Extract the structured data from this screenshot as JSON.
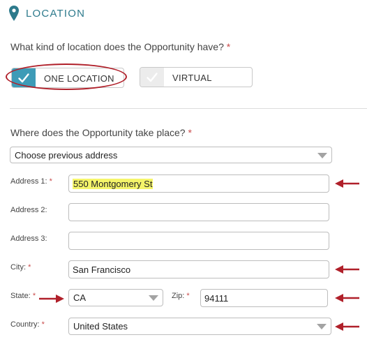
{
  "section": {
    "title": "LOCATION",
    "icon": "map-pin-icon"
  },
  "location_type": {
    "question": "What kind of location does the Opportunity have?",
    "required_mark": "*",
    "options": [
      {
        "label": "ONE LOCATION",
        "selected": true
      },
      {
        "label": "VIRTUAL",
        "selected": false
      }
    ]
  },
  "address": {
    "question": "Where does the Opportunity take place?",
    "required_mark": "*",
    "previous_address": {
      "value": "Choose previous address"
    },
    "address1": {
      "label": "Address 1:",
      "required_mark": "*",
      "value": "550 Montgomery St"
    },
    "address2": {
      "label": "Address 2:",
      "value": ""
    },
    "address3": {
      "label": "Address 3:",
      "value": ""
    },
    "city": {
      "label": "City:",
      "required_mark": "*",
      "value": "San Francisco"
    },
    "state": {
      "label": "State:",
      "required_mark": "*",
      "value": "CA"
    },
    "zip": {
      "label": "Zip:",
      "required_mark": "*",
      "value": "94111"
    },
    "country": {
      "label": "Country:",
      "required_mark": "*",
      "value": "United States"
    }
  },
  "colors": {
    "accent": "#2d7a8c",
    "active_toggle": "#3d9bb7",
    "annotation_red": "#b0202a",
    "highlight": "#f5f56a"
  }
}
